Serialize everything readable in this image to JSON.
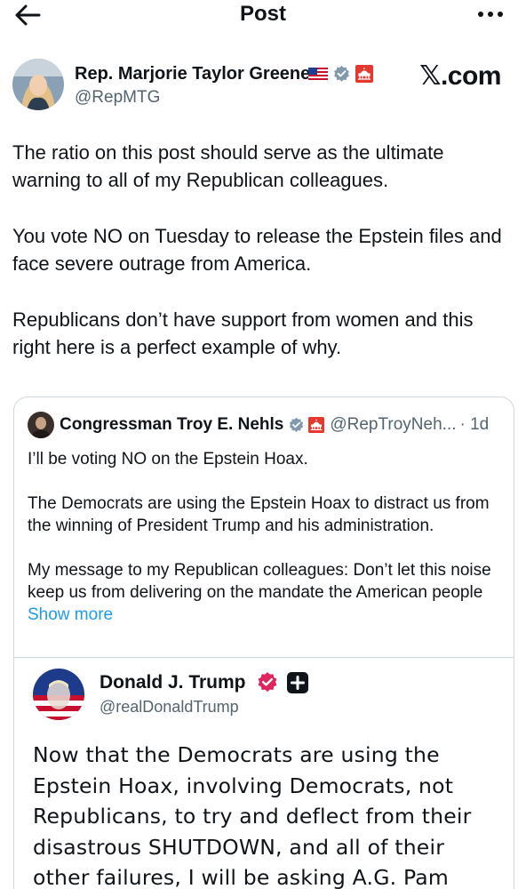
{
  "header": {
    "title": "Post",
    "back_icon": "arrow-left-icon",
    "more_icon": "more-horizontal-icon"
  },
  "post": {
    "author_name": "Rep. Marjorie Taylor Greene",
    "author_handle": "@RepMTG",
    "watermark": "𝕏.com",
    "badges": [
      "us-flag-icon",
      "gray-verified-icon",
      "capitol-icon"
    ],
    "paragraphs": [
      "The ratio on this post should serve as the ultimate warning to all of my Republican colleagues.",
      "You vote NO on Tuesday to release the Epstein files and face severe outrage from America.",
      "Republicans don’t have support from women and this right here is a perfect example of why."
    ]
  },
  "quote": {
    "author_name": "Congressman Troy E. Nehls",
    "handle": "@RepTroyNeh...",
    "time": "· 1d",
    "paragraphs": [
      "I’ll be voting NO on the Epstein Hoax.",
      "The Democrats are using the Epstein Hoax to distract us from the winning of President Trump and his administration.",
      "My message to my Republican colleagues: Don’t let this noise keep us from delivering on the mandate the American people"
    ],
    "show_more": "Show more",
    "nested": {
      "author_name": "Donald J. Trump",
      "handle": "@realDonaldTrump",
      "text": "Now that the Democrats are using the Epstein Hoax, involving Democrats, not Republicans, to try and deflect from their disastrous SHUTDOWN, and all of their other failures, I will be asking A.G. Pam"
    }
  },
  "colors": {
    "text": "#0f1419",
    "secondary": "#536471",
    "link": "#1d9bf0",
    "border": "#cfd9de",
    "verified_gray": "#829aab",
    "verified_pink": "#e0245e"
  }
}
